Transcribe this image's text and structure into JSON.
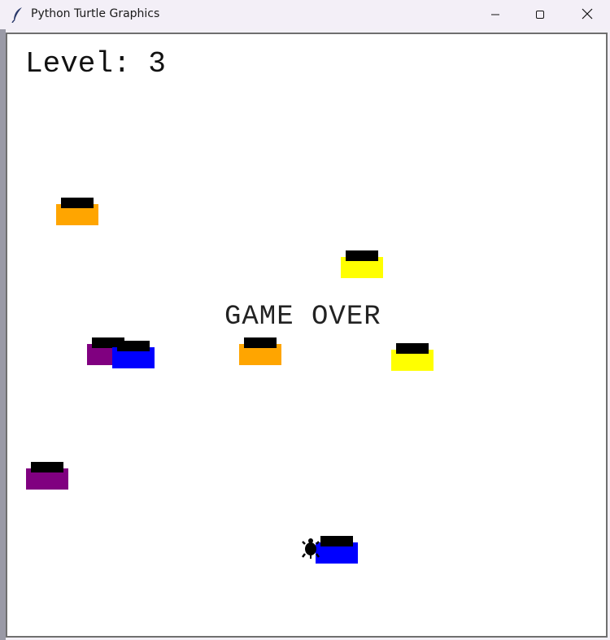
{
  "window": {
    "title": "Python Turtle Graphics",
    "icon": "feather-icon",
    "controls": [
      "minimize-icon",
      "maximize-icon",
      "close-icon"
    ]
  },
  "game": {
    "level_label": "Level: 3",
    "status_text": "GAME OVER",
    "player": "turtle",
    "cars": [
      {
        "color": "#FFA500"
      },
      {
        "color": "#FFFF00"
      },
      {
        "color": "#800080"
      },
      {
        "color": "#0000FF"
      },
      {
        "color": "#FFA500"
      },
      {
        "color": "#FFFF00"
      },
      {
        "color": "#800080"
      },
      {
        "color": "#0000FF"
      }
    ]
  }
}
